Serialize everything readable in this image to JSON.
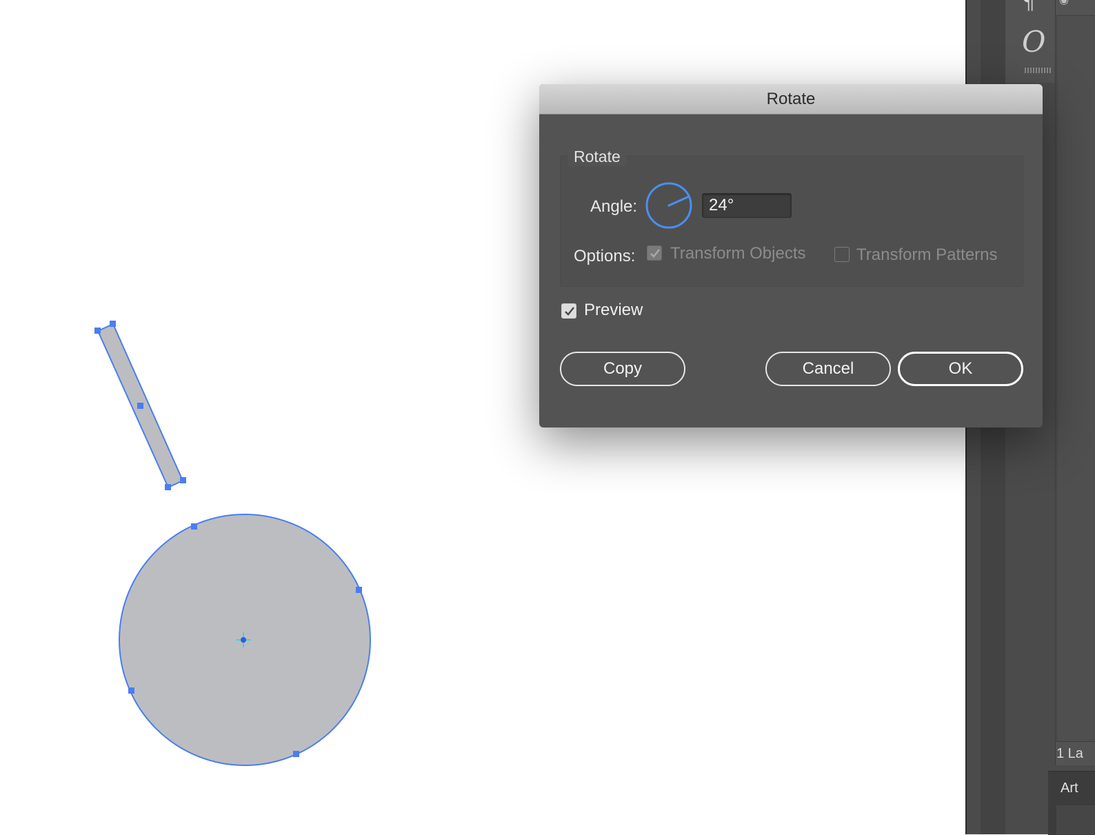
{
  "dialog": {
    "title": "Rotate",
    "group_label": "Rotate",
    "angle_label": "Angle:",
    "angle_value": "24°",
    "angle_degrees": 24,
    "options_label": "Options:",
    "transform_objects": {
      "label": "Transform Objects",
      "checked": true,
      "enabled": false
    },
    "transform_patterns": {
      "label": "Transform Patterns",
      "checked": false,
      "enabled": false
    },
    "preview": {
      "label": "Preview",
      "checked": true
    },
    "buttons": {
      "copy": "Copy",
      "cancel": "Cancel",
      "ok": "OK"
    }
  },
  "right_panel": {
    "layers_count": "1 La",
    "artboards_tab": "Art"
  },
  "colors": {
    "selection": "#4a7df0",
    "shape_fill": "#bcbdc0",
    "dialog_bg": "#535353",
    "center_point": "#3fd0e6"
  }
}
